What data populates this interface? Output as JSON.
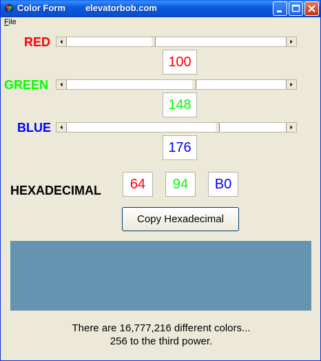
{
  "window": {
    "title": "Color Form        elevatorbob.com"
  },
  "menu": {
    "file": "File"
  },
  "channels": {
    "red": {
      "label": "RED",
      "value": "100",
      "color": "#ff0000",
      "hex": "64"
    },
    "green": {
      "label": "GREEN",
      "value": "148",
      "color": "#00ff00",
      "hex": "94"
    },
    "blue": {
      "label": "BLUE",
      "value": "176",
      "color": "#0000ff",
      "hex": "B0"
    }
  },
  "slider_max": 255,
  "hex_label": "HEXADECIMAL",
  "copy_button": "Copy Hexadecimal",
  "preview_color": "#6494b0",
  "footer": {
    "line1": "There are 16,777,216 different colors...",
    "line2": "256 to the third power."
  },
  "icons": {
    "app": "color-wheel-icon",
    "minimize": "minimize-icon",
    "maximize": "maximize-icon",
    "close": "close-icon",
    "scroll_left": "left-arrow-icon",
    "scroll_right": "right-arrow-icon"
  }
}
